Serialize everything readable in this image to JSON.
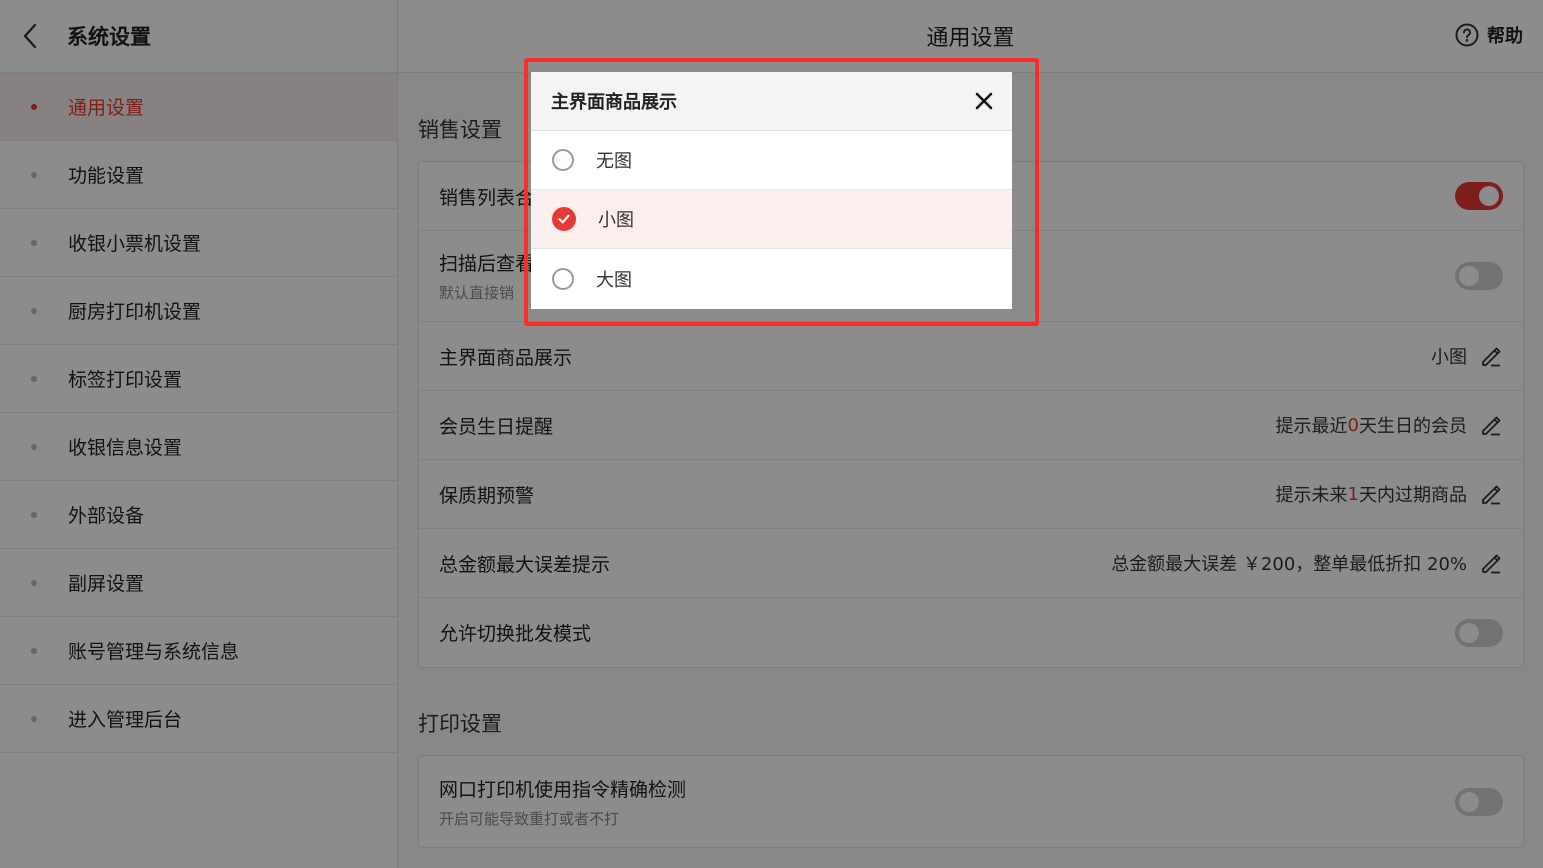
{
  "sidebar": {
    "title": "系统设置",
    "items": [
      {
        "label": "通用设置",
        "active": true
      },
      {
        "label": "功能设置"
      },
      {
        "label": "收银小票机设置"
      },
      {
        "label": "厨房打印机设置"
      },
      {
        "label": "标签打印设置"
      },
      {
        "label": "收银信息设置"
      },
      {
        "label": "外部设备"
      },
      {
        "label": "副屏设置"
      },
      {
        "label": "账号管理与系统信息"
      },
      {
        "label": "进入管理后台"
      }
    ]
  },
  "header": {
    "title": "通用设置",
    "help_label": "帮助"
  },
  "sales": {
    "section_title": "销售设置",
    "rows": {
      "sales_list": {
        "label": "销售列表合",
        "toggle": true
      },
      "scan_view": {
        "label": "扫描后查看",
        "sub": "默认直接销",
        "toggle": false
      },
      "main_display": {
        "label": "主界面商品展示",
        "value": "小图"
      },
      "birthday": {
        "label": "会员生日提醒",
        "pre": "提示最近",
        "num": "0",
        "post": "天生日的会员"
      },
      "expiry": {
        "label": "保质期预警",
        "pre": "提示未来",
        "num": "1",
        "post": "天内过期商品"
      },
      "error_tip": {
        "label": "总金额最大误差提示",
        "value": "总金额最大误差 ￥200，整单最低折扣 20%"
      },
      "wholesale": {
        "label": "允许切换批发模式",
        "toggle": false
      }
    }
  },
  "print": {
    "section_title": "打印设置",
    "net_printer": {
      "label": "网口打印机使用指令精确检测",
      "sub": "开启可能导致重打或者不打",
      "toggle": false
    }
  },
  "dialog": {
    "title": "主界面商品展示",
    "options": [
      {
        "label": "无图",
        "selected": false
      },
      {
        "label": "小图",
        "selected": true
      },
      {
        "label": "大图",
        "selected": false
      }
    ]
  },
  "colors": {
    "accent": "#e53935",
    "highlight_box": "#ff2a2a"
  }
}
